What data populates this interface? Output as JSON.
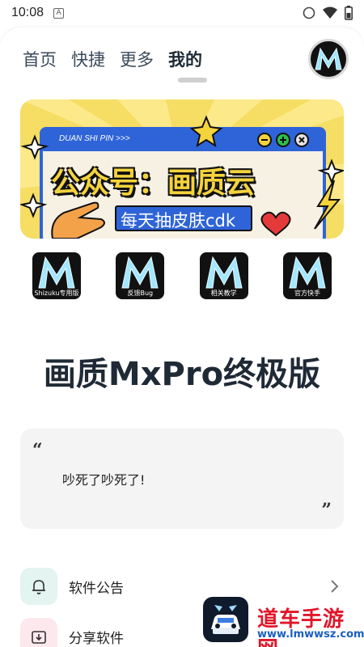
{
  "status_bar": {
    "time": "10:08",
    "notification_letter": "A"
  },
  "tabs": [
    {
      "label": "首页",
      "active": false
    },
    {
      "label": "快捷",
      "active": false
    },
    {
      "label": "更多",
      "active": false
    },
    {
      "label": "我的",
      "active": true
    }
  ],
  "banner": {
    "window_title": "DUAN SHI PIN >>>",
    "headline": "公众号：画质云",
    "subline": "每天抽皮肤cdk"
  },
  "quick_actions": [
    {
      "label": "Shizuku专用版"
    },
    {
      "label": "反馈Bug"
    },
    {
      "label": "相关教学"
    },
    {
      "label": "官方快手"
    }
  ],
  "app_title": "画质MxPro终极版",
  "quote": {
    "open_mark": "“",
    "text": "吵死了吵死了!",
    "close_mark": "”"
  },
  "menu": [
    {
      "label": "软件公告",
      "icon": "bell-icon",
      "icon_bg": "#e3f4f1"
    },
    {
      "label": "分享软件",
      "icon": "share-download-icon",
      "icon_bg": "#fde8ee"
    }
  ],
  "watermark": {
    "text": "道车手游网",
    "url": "www.lmwwsz.com"
  },
  "colors": {
    "accent_dark": "#1f2a36",
    "banner_yellow": "#f6dd63",
    "banner_blue": "#2f64d8",
    "watermark_red": "#e0172a"
  }
}
